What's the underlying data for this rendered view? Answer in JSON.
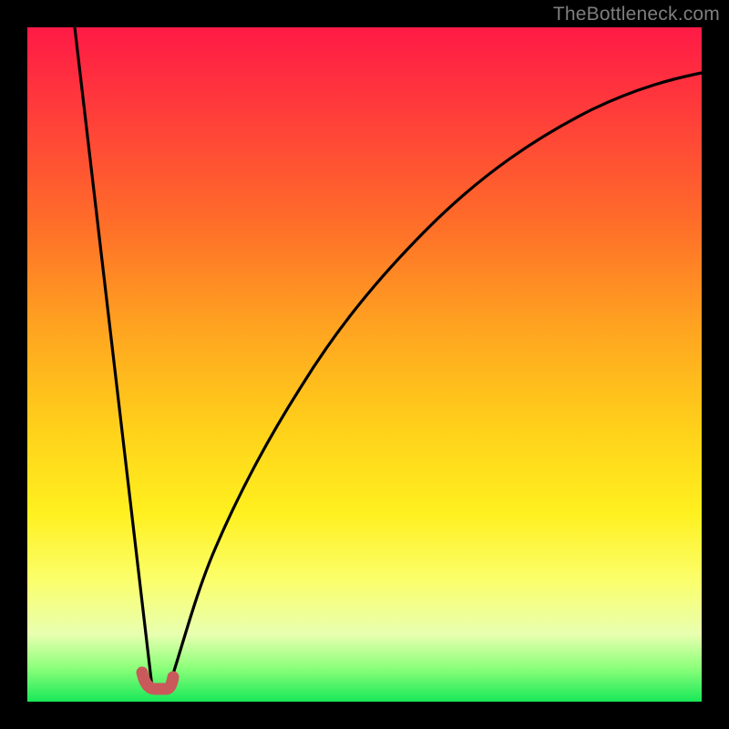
{
  "watermark": "TheBottleneck.com",
  "chart_data": {
    "type": "line",
    "title": "",
    "xlabel": "",
    "ylabel": "",
    "xlim": [
      0,
      100
    ],
    "ylim": [
      0,
      100
    ],
    "grid": false,
    "series": [
      {
        "name": "descending-line",
        "x": [
          7,
          18.5
        ],
        "values": [
          100,
          2
        ]
      },
      {
        "name": "valley-marker",
        "x": [
          17.0,
          18.5,
          21.0,
          21.5
        ],
        "values": [
          4.3,
          2.0,
          2.0,
          3.6
        ]
      },
      {
        "name": "rising-curve",
        "x": [
          21,
          24,
          28,
          33,
          39,
          46,
          55,
          65,
          78,
          90,
          100
        ],
        "values": [
          2,
          11,
          23,
          36,
          49,
          61,
          72,
          80,
          87,
          91,
          93
        ]
      }
    ],
    "background_gradient": {
      "top_color": "#ff1a46",
      "bottom_color": "#18e858"
    }
  }
}
